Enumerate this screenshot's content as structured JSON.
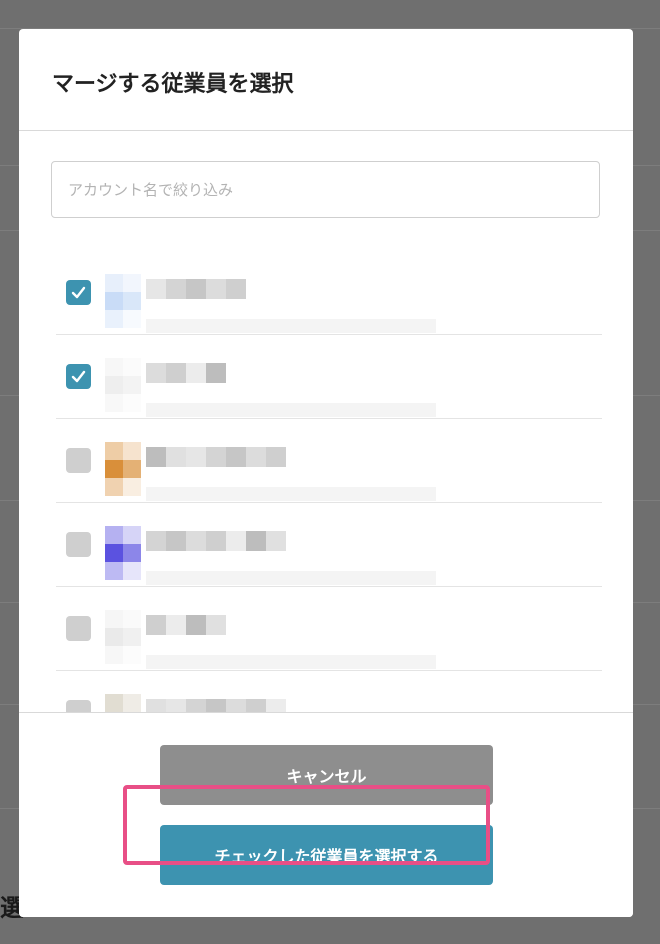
{
  "dialog": {
    "title": "マージする従業員を選択",
    "search_placeholder": "アカウント名で絞り込み",
    "search_value": ""
  },
  "employees": [
    {
      "checked": true,
      "avatar_color": "#c9dcf7",
      "name_redacted": true
    },
    {
      "checked": true,
      "avatar_color": "#eeeeee",
      "name_redacted": true
    },
    {
      "checked": false,
      "avatar_color": "#d98f3a",
      "name_redacted": true
    },
    {
      "checked": false,
      "avatar_color": "#5b52e0",
      "name_redacted": true
    },
    {
      "checked": false,
      "avatar_color": "#eaeaea",
      "name_redacted": true
    },
    {
      "checked": false,
      "avatar_color": "#bdb49c",
      "name_redacted": true
    }
  ],
  "footer": {
    "cancel_label": "キャンセル",
    "confirm_label": "チェックした従業員を選択する"
  },
  "background": {
    "partial_text": "選"
  },
  "colors": {
    "accent": "#3d93b0",
    "cancel": "#8e8e8e",
    "checkbox_off": "#cfcfcf",
    "highlight": "#e84f86"
  }
}
